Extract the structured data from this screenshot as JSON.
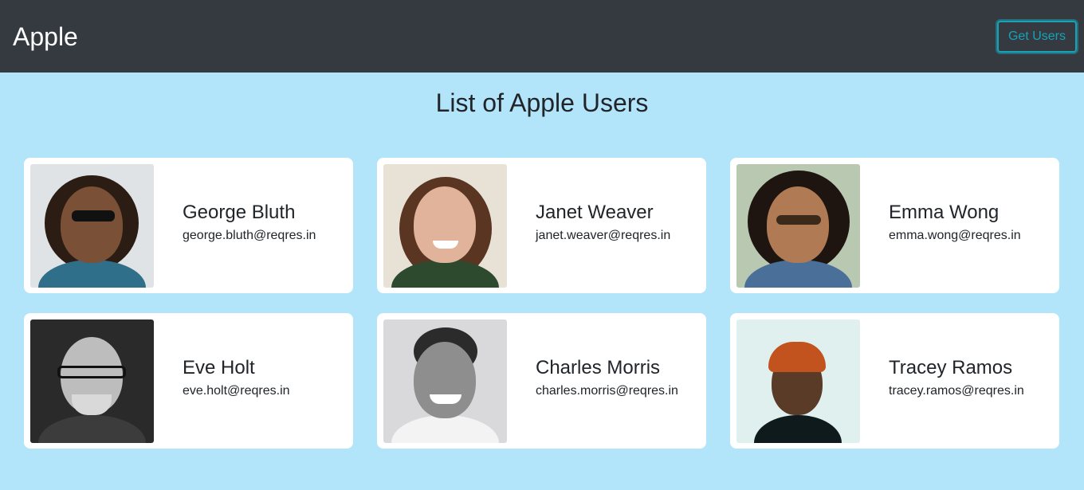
{
  "navbar": {
    "brand": "Apple",
    "button_label": "Get Users"
  },
  "page": {
    "title": "List of Apple Users"
  },
  "users": [
    {
      "name": "George Bluth",
      "email": "george.bluth@reqres.in"
    },
    {
      "name": "Janet Weaver",
      "email": "janet.weaver@reqres.in"
    },
    {
      "name": "Emma Wong",
      "email": "emma.wong@reqres.in"
    },
    {
      "name": "Eve Holt",
      "email": "eve.holt@reqres.in"
    },
    {
      "name": "Charles Morris",
      "email": "charles.morris@reqres.in"
    },
    {
      "name": "Tracey Ramos",
      "email": "tracey.ramos@reqres.in"
    }
  ],
  "colors": {
    "navbar_bg": "#343a40",
    "page_bg": "#b3e5fa",
    "button_accent": "#17a2b8"
  }
}
